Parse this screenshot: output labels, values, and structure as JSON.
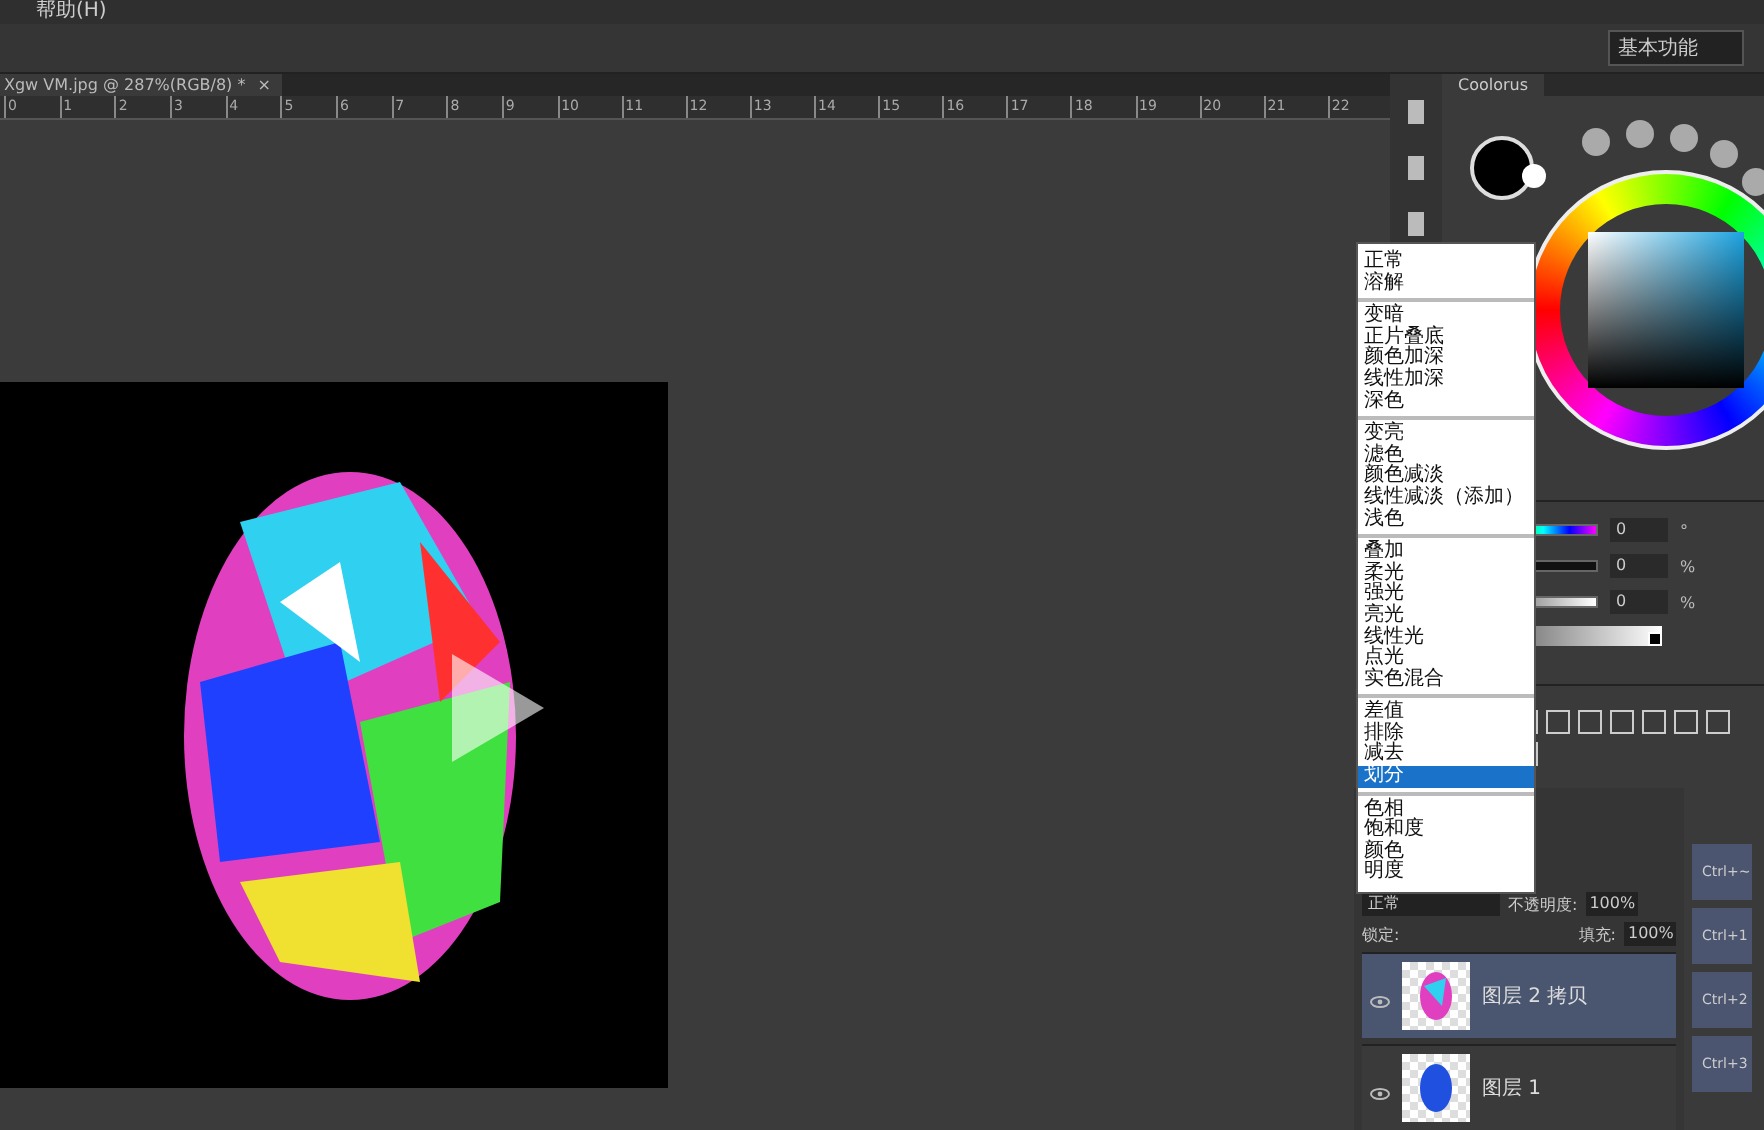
{
  "menubar": {
    "items": [
      "帮助(H)"
    ]
  },
  "workspace": "基本功能",
  "document_tab": {
    "title": "Xgw VM.jpg @ 287%(RGB/8) *",
    "close": "×"
  },
  "ruler": [
    "0",
    "1",
    "2",
    "3",
    "4",
    "5",
    "6",
    "7",
    "8",
    "9",
    "10",
    "11",
    "12",
    "13",
    "14",
    "15",
    "16",
    "17",
    "18",
    "19",
    "20",
    "21",
    "22"
  ],
  "color_panel": {
    "title": "Coolorus"
  },
  "sliders": [
    {
      "value": "0",
      "unit": "°",
      "kind": "hue"
    },
    {
      "value": "0",
      "unit": "%",
      "kind": "dark"
    },
    {
      "value": "0",
      "unit": "%",
      "kind": "light"
    }
  ],
  "tone_ramp": {
    "level": 1
  },
  "blend_menu": {
    "groups": [
      [
        {
          "label": "正常",
          "selected": false
        },
        {
          "label": "溶解",
          "selected": false
        }
      ],
      [
        {
          "label": "变暗",
          "selected": false
        },
        {
          "label": "正片叠底",
          "selected": false
        },
        {
          "label": "颜色加深",
          "selected": false
        },
        {
          "label": "线性加深",
          "selected": false
        },
        {
          "label": "深色",
          "selected": false
        }
      ],
      [
        {
          "label": "变亮",
          "selected": false
        },
        {
          "label": "滤色",
          "selected": false
        },
        {
          "label": "颜色减淡",
          "selected": false
        },
        {
          "label": "线性减淡（添加）",
          "selected": false
        },
        {
          "label": "浅色",
          "selected": false
        }
      ],
      [
        {
          "label": "叠加",
          "selected": false
        },
        {
          "label": "柔光",
          "selected": false
        },
        {
          "label": "强光",
          "selected": false
        },
        {
          "label": "亮光",
          "selected": false
        },
        {
          "label": "线性光",
          "selected": false
        },
        {
          "label": "点光",
          "selected": false
        },
        {
          "label": "实色混合",
          "selected": false
        }
      ],
      [
        {
          "label": "差值",
          "selected": false
        },
        {
          "label": "排除",
          "selected": false
        },
        {
          "label": "减去",
          "selected": false
        },
        {
          "label": "划分",
          "selected": true
        }
      ],
      [
        {
          "label": "色相",
          "selected": false
        },
        {
          "label": "饱和度",
          "selected": false
        },
        {
          "label": "颜色",
          "selected": false
        },
        {
          "label": "明度",
          "selected": false
        }
      ]
    ]
  },
  "layers": {
    "blend_mode": "正常",
    "opacity_label": "不透明度:",
    "opacity": "100%",
    "lock_label": "锁定:",
    "fill_label": "填充:",
    "fill": "100%",
    "items": [
      {
        "name": "图层 2 拷贝",
        "selected": true,
        "visible": true
      },
      {
        "name": "图层 1",
        "selected": false,
        "visible": true
      }
    ]
  },
  "channels": [
    {
      "shortcut": "Ctrl+~"
    },
    {
      "shortcut": "Ctrl+1"
    },
    {
      "shortcut": "Ctrl+2"
    },
    {
      "shortcut": "Ctrl+3"
    }
  ]
}
